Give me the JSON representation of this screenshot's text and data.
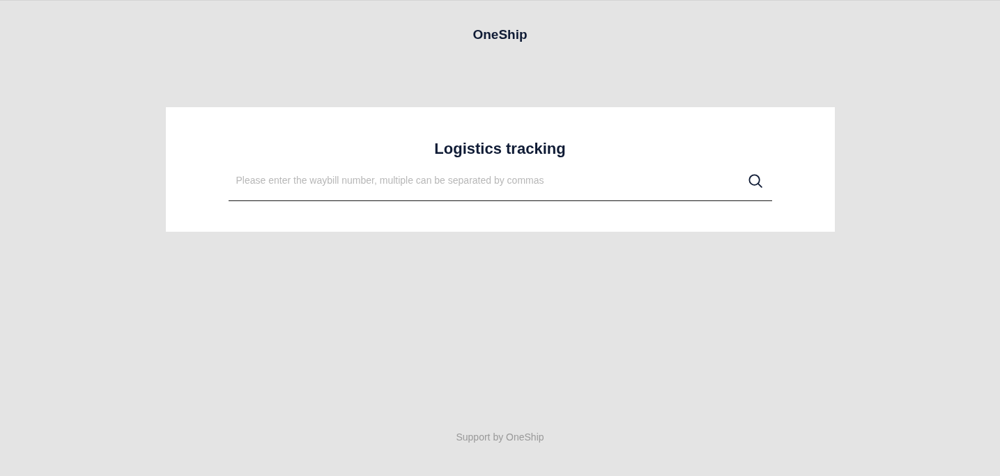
{
  "header": {
    "brand": "OneShip"
  },
  "tracking_card": {
    "title": "Logistics tracking",
    "search": {
      "placeholder": "Please enter the waybill number, multiple can be separated by commas"
    }
  },
  "footer": {
    "text": "Support by OneShip"
  }
}
